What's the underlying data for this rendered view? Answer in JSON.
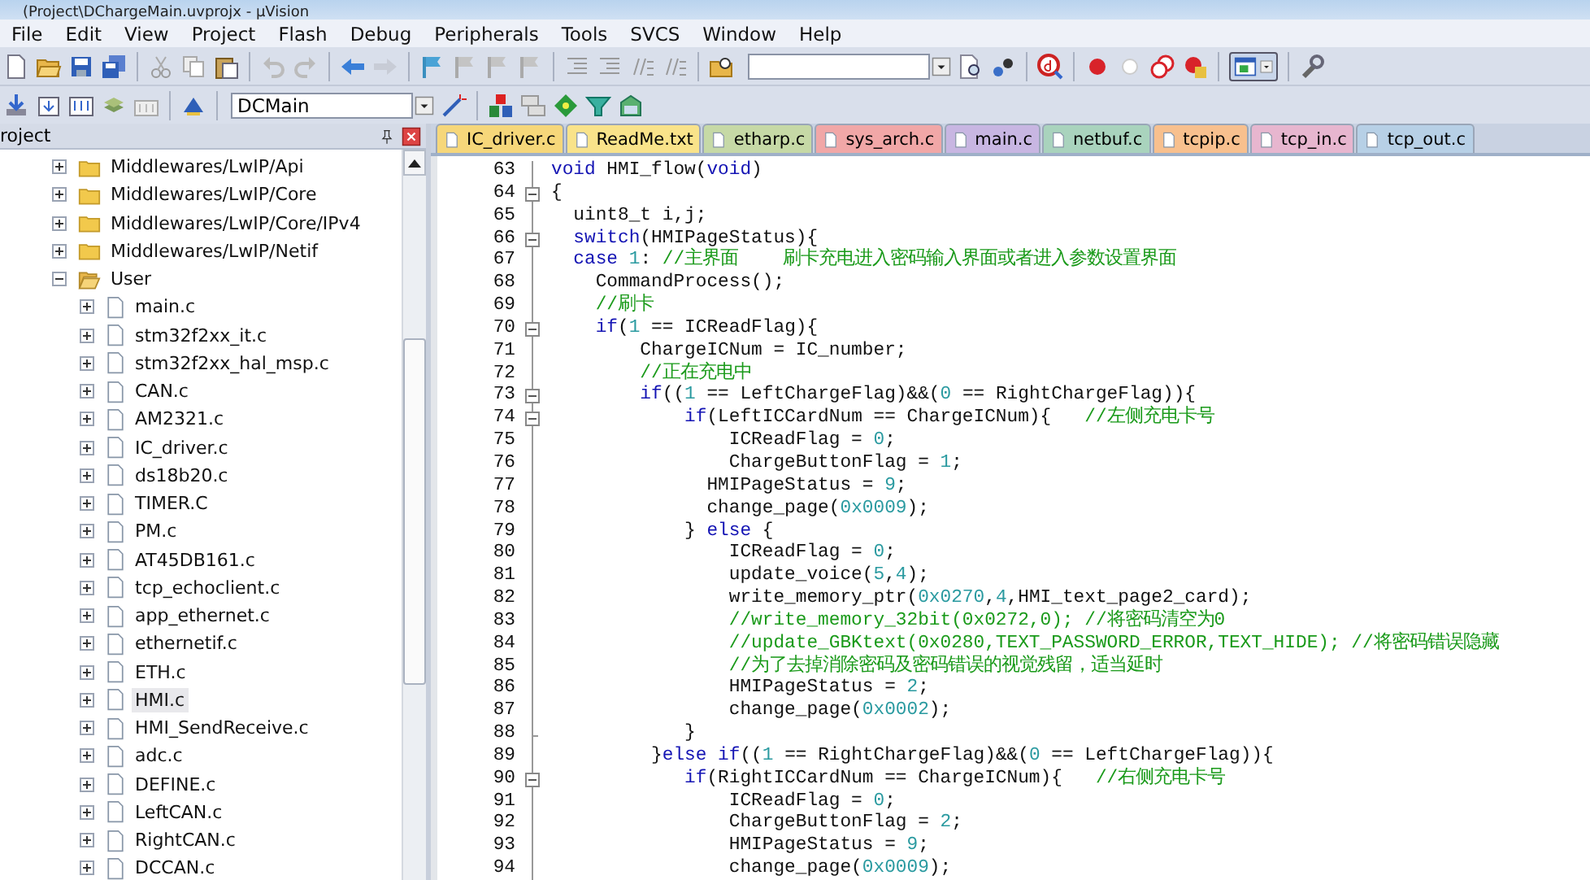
{
  "window": {
    "title": "(Project\\DChargeMain.uvprojx - µVision"
  },
  "menu": [
    "File",
    "Edit",
    "View",
    "Project",
    "Flash",
    "Debug",
    "Peripherals",
    "Tools",
    "SVCS",
    "Window",
    "Help"
  ],
  "build_toolbar": {
    "target": "DCMain"
  },
  "project_panel": {
    "title": "roject",
    "tree": [
      {
        "label": "Middlewares/LwIP/Api",
        "kind": "folder",
        "expanded": false,
        "selected": false
      },
      {
        "label": "Middlewares/LwIP/Core",
        "kind": "folder",
        "expanded": false,
        "selected": false
      },
      {
        "label": "Middlewares/LwIP/Core/IPv4",
        "kind": "folder",
        "expanded": false,
        "selected": false
      },
      {
        "label": "Middlewares/LwIP/Netif",
        "kind": "folder",
        "expanded": false,
        "selected": false
      },
      {
        "label": "User",
        "kind": "folder",
        "expanded": true,
        "selected": false,
        "children": [
          {
            "label": "main.c",
            "kind": "file",
            "expanded": false,
            "selected": false
          },
          {
            "label": "stm32f2xx_it.c",
            "kind": "file",
            "expanded": false,
            "selected": false
          },
          {
            "label": "stm32f2xx_hal_msp.c",
            "kind": "file",
            "expanded": false,
            "selected": false
          },
          {
            "label": "CAN.c",
            "kind": "file",
            "expanded": false,
            "selected": false
          },
          {
            "label": "AM2321.c",
            "kind": "file",
            "expanded": false,
            "selected": false
          },
          {
            "label": "IC_driver.c",
            "kind": "file",
            "expanded": false,
            "selected": false
          },
          {
            "label": "ds18b20.c",
            "kind": "file",
            "expanded": false,
            "selected": false
          },
          {
            "label": "TIMER.C",
            "kind": "file",
            "expanded": false,
            "selected": false
          },
          {
            "label": "PM.c",
            "kind": "file",
            "expanded": false,
            "selected": false
          },
          {
            "label": "AT45DB161.c",
            "kind": "file",
            "expanded": false,
            "selected": false
          },
          {
            "label": "tcp_echoclient.c",
            "kind": "file",
            "expanded": false,
            "selected": false
          },
          {
            "label": "app_ethernet.c",
            "kind": "file",
            "expanded": false,
            "selected": false
          },
          {
            "label": "ethernetif.c",
            "kind": "file",
            "expanded": false,
            "selected": false
          },
          {
            "label": "ETH.c",
            "kind": "file",
            "expanded": false,
            "selected": false
          },
          {
            "label": "HMI.c",
            "kind": "file",
            "expanded": false,
            "selected": true
          },
          {
            "label": "HMI_SendReceive.c",
            "kind": "file",
            "expanded": false,
            "selected": false
          },
          {
            "label": "adc.c",
            "kind": "file",
            "expanded": false,
            "selected": false
          },
          {
            "label": "DEFINE.c",
            "kind": "file",
            "expanded": false,
            "selected": false
          },
          {
            "label": "LeftCAN.c",
            "kind": "file",
            "expanded": false,
            "selected": false
          },
          {
            "label": "RightCAN.c",
            "kind": "file",
            "expanded": false,
            "selected": false
          },
          {
            "label": "DCCAN.c",
            "kind": "file",
            "expanded": false,
            "selected": false
          }
        ]
      }
    ]
  },
  "tabs": [
    {
      "label": "IC_driver.c",
      "color": "#f6d77a"
    },
    {
      "label": "ReadMe.txt",
      "color": "#f9e38a"
    },
    {
      "label": "etharp.c",
      "color": "#c6d9a6"
    },
    {
      "label": "sys_arch.c",
      "color": "#f1a7a7"
    },
    {
      "label": "main.c",
      "color": "#c8b6e2"
    },
    {
      "label": "netbuf.c",
      "color": "#a9d3bd"
    },
    {
      "label": "tcpip.c",
      "color": "#f8c08e"
    },
    {
      "label": "tcp_in.c",
      "color": "#e7b6cf"
    },
    {
      "label": "tcp_out.c",
      "color": "#b7d0e6"
    }
  ],
  "editor": {
    "lines": [
      {
        "number": "63",
        "fold_toggle": false,
        "block_end": false,
        "parts": [
          {
            "kind": "keyword",
            "text": "void"
          },
          {
            "kind": "code",
            "text": " HMI_flow("
          },
          {
            "kind": "keyword",
            "text": "void"
          },
          {
            "kind": "code",
            "text": ")"
          }
        ]
      },
      {
        "number": "64",
        "fold_toggle": true,
        "block_end": false,
        "parts": [
          {
            "kind": "code",
            "text": "{"
          }
        ]
      },
      {
        "number": "65",
        "fold_toggle": false,
        "block_end": false,
        "parts": [
          {
            "kind": "code",
            "text": "  uint8_t i,j;"
          }
        ]
      },
      {
        "number": "66",
        "fold_toggle": true,
        "block_end": false,
        "parts": [
          {
            "kind": "keyword",
            "text": "  switch"
          },
          {
            "kind": "code",
            "text": "(HMIPageStatus){"
          }
        ]
      },
      {
        "number": "67",
        "fold_toggle": false,
        "block_end": false,
        "parts": [
          {
            "kind": "keyword",
            "text": "  case"
          },
          {
            "kind": "number",
            "text": " 1"
          },
          {
            "kind": "code",
            "text": ": "
          },
          {
            "kind": "comment",
            "text": "//主界面    刷卡充电进入密码输入界面或者进入参数设置界面"
          }
        ]
      },
      {
        "number": "68",
        "fold_toggle": false,
        "block_end": false,
        "parts": [
          {
            "kind": "code",
            "text": "    CommandProcess();"
          }
        ]
      },
      {
        "number": "69",
        "fold_toggle": false,
        "block_end": false,
        "parts": [
          {
            "kind": "comment",
            "text": "    //刷卡"
          }
        ]
      },
      {
        "number": "70",
        "fold_toggle": true,
        "block_end": false,
        "parts": [
          {
            "kind": "keyword",
            "text": "    if"
          },
          {
            "kind": "code",
            "text": "("
          },
          {
            "kind": "number",
            "text": "1"
          },
          {
            "kind": "code",
            "text": " == ICReadFlag){"
          }
        ]
      },
      {
        "number": "71",
        "fold_toggle": false,
        "block_end": false,
        "parts": [
          {
            "kind": "code",
            "text": "        ChargeICNum = IC_number;"
          }
        ]
      },
      {
        "number": "72",
        "fold_toggle": false,
        "block_end": false,
        "parts": [
          {
            "kind": "comment",
            "text": "        //正在充电中"
          }
        ]
      },
      {
        "number": "73",
        "fold_toggle": true,
        "block_end": false,
        "parts": [
          {
            "kind": "keyword",
            "text": "        if"
          },
          {
            "kind": "code",
            "text": "(("
          },
          {
            "kind": "number",
            "text": "1"
          },
          {
            "kind": "code",
            "text": " == LeftChargeFlag)&&("
          },
          {
            "kind": "number",
            "text": "0"
          },
          {
            "kind": "code",
            "text": " == RightChargeFlag)){"
          }
        ]
      },
      {
        "number": "74",
        "fold_toggle": true,
        "block_end": false,
        "parts": [
          {
            "kind": "keyword",
            "text": "            if"
          },
          {
            "kind": "code",
            "text": "(LeftICCardNum == ChargeICNum){   "
          },
          {
            "kind": "comment",
            "text": "//左侧充电卡号"
          }
        ]
      },
      {
        "number": "75",
        "fold_toggle": false,
        "block_end": false,
        "parts": [
          {
            "kind": "code",
            "text": "                ICReadFlag = "
          },
          {
            "kind": "number",
            "text": "0"
          },
          {
            "kind": "code",
            "text": ";"
          }
        ]
      },
      {
        "number": "76",
        "fold_toggle": false,
        "block_end": false,
        "parts": [
          {
            "kind": "code",
            "text": "                ChargeButtonFlag = "
          },
          {
            "kind": "number",
            "text": "1"
          },
          {
            "kind": "code",
            "text": ";"
          }
        ]
      },
      {
        "number": "77",
        "fold_toggle": false,
        "block_end": false,
        "parts": [
          {
            "kind": "code",
            "text": "              HMIPageStatus = "
          },
          {
            "kind": "number",
            "text": "9"
          },
          {
            "kind": "code",
            "text": ";"
          }
        ]
      },
      {
        "number": "78",
        "fold_toggle": false,
        "block_end": false,
        "parts": [
          {
            "kind": "code",
            "text": "              change_page("
          },
          {
            "kind": "number",
            "text": "0x0009"
          },
          {
            "kind": "code",
            "text": ");"
          }
        ]
      },
      {
        "number": "79",
        "fold_toggle": false,
        "block_end": false,
        "parts": [
          {
            "kind": "code",
            "text": "            } "
          },
          {
            "kind": "keyword",
            "text": "else"
          },
          {
            "kind": "code",
            "text": " {"
          }
        ]
      },
      {
        "number": "80",
        "fold_toggle": false,
        "block_end": false,
        "parts": [
          {
            "kind": "code",
            "text": "                ICReadFlag = "
          },
          {
            "kind": "number",
            "text": "0"
          },
          {
            "kind": "code",
            "text": ";"
          }
        ]
      },
      {
        "number": "81",
        "fold_toggle": false,
        "block_end": false,
        "parts": [
          {
            "kind": "code",
            "text": "                update_voice("
          },
          {
            "kind": "number",
            "text": "5"
          },
          {
            "kind": "code",
            "text": ","
          },
          {
            "kind": "number",
            "text": "4"
          },
          {
            "kind": "code",
            "text": ");"
          }
        ]
      },
      {
        "number": "82",
        "fold_toggle": false,
        "block_end": false,
        "parts": [
          {
            "kind": "code",
            "text": "                write_memory_ptr("
          },
          {
            "kind": "number",
            "text": "0x0270"
          },
          {
            "kind": "code",
            "text": ","
          },
          {
            "kind": "number",
            "text": "4"
          },
          {
            "kind": "code",
            "text": ",HMI_text_page2_card);"
          }
        ]
      },
      {
        "number": "83",
        "fold_toggle": false,
        "block_end": false,
        "parts": [
          {
            "kind": "comment",
            "text": "                //write_memory_32bit(0x0272,0); //将密码清空为0"
          }
        ]
      },
      {
        "number": "84",
        "fold_toggle": false,
        "block_end": false,
        "parts": [
          {
            "kind": "comment",
            "text": "                //update_GBKtext(0x0280,TEXT_PASSWORD_ERROR,TEXT_HIDE); //将密码错误隐藏"
          }
        ]
      },
      {
        "number": "85",
        "fold_toggle": false,
        "block_end": false,
        "parts": [
          {
            "kind": "comment",
            "text": "                //为了去掉消除密码及密码错误的视觉残留，适当延时"
          }
        ]
      },
      {
        "number": "86",
        "fold_toggle": false,
        "block_end": false,
        "parts": [
          {
            "kind": "code",
            "text": "                HMIPageStatus = "
          },
          {
            "kind": "number",
            "text": "2"
          },
          {
            "kind": "code",
            "text": ";"
          }
        ]
      },
      {
        "number": "87",
        "fold_toggle": false,
        "block_end": false,
        "parts": [
          {
            "kind": "code",
            "text": "                change_page("
          },
          {
            "kind": "number",
            "text": "0x0002"
          },
          {
            "kind": "code",
            "text": ");"
          }
        ]
      },
      {
        "number": "88",
        "fold_toggle": false,
        "block_end": true,
        "parts": [
          {
            "kind": "code",
            "text": "            }"
          }
        ]
      },
      {
        "number": "89",
        "fold_toggle": false,
        "block_end": false,
        "parts": [
          {
            "kind": "code",
            "text": "         }"
          },
          {
            "kind": "keyword",
            "text": "else if"
          },
          {
            "kind": "code",
            "text": "(("
          },
          {
            "kind": "number",
            "text": "1"
          },
          {
            "kind": "code",
            "text": " == RightChargeFlag)&&("
          },
          {
            "kind": "number",
            "text": "0"
          },
          {
            "kind": "code",
            "text": " == LeftChargeFlag)){"
          }
        ]
      },
      {
        "number": "90",
        "fold_toggle": true,
        "block_end": false,
        "parts": [
          {
            "kind": "keyword",
            "text": "            if"
          },
          {
            "kind": "code",
            "text": "(RightICCardNum == ChargeICNum){   "
          },
          {
            "kind": "comment",
            "text": "//右侧充电卡号"
          }
        ]
      },
      {
        "number": "91",
        "fold_toggle": false,
        "block_end": false,
        "parts": [
          {
            "kind": "code",
            "text": "                ICReadFlag = "
          },
          {
            "kind": "number",
            "text": "0"
          },
          {
            "kind": "code",
            "text": ";"
          }
        ]
      },
      {
        "number": "92",
        "fold_toggle": false,
        "block_end": false,
        "parts": [
          {
            "kind": "code",
            "text": "                ChargeButtonFlag = "
          },
          {
            "kind": "number",
            "text": "2"
          },
          {
            "kind": "code",
            "text": ";"
          }
        ]
      },
      {
        "number": "93",
        "fold_toggle": false,
        "block_end": false,
        "parts": [
          {
            "kind": "code",
            "text": "                HMIPageStatus = "
          },
          {
            "kind": "number",
            "text": "9"
          },
          {
            "kind": "code",
            "text": ";"
          }
        ]
      },
      {
        "number": "94",
        "fold_toggle": false,
        "block_end": false,
        "parts": [
          {
            "kind": "code",
            "text": "                change_page("
          },
          {
            "kind": "number",
            "text": "0x0009"
          },
          {
            "kind": "code",
            "text": ");"
          }
        ]
      }
    ]
  }
}
